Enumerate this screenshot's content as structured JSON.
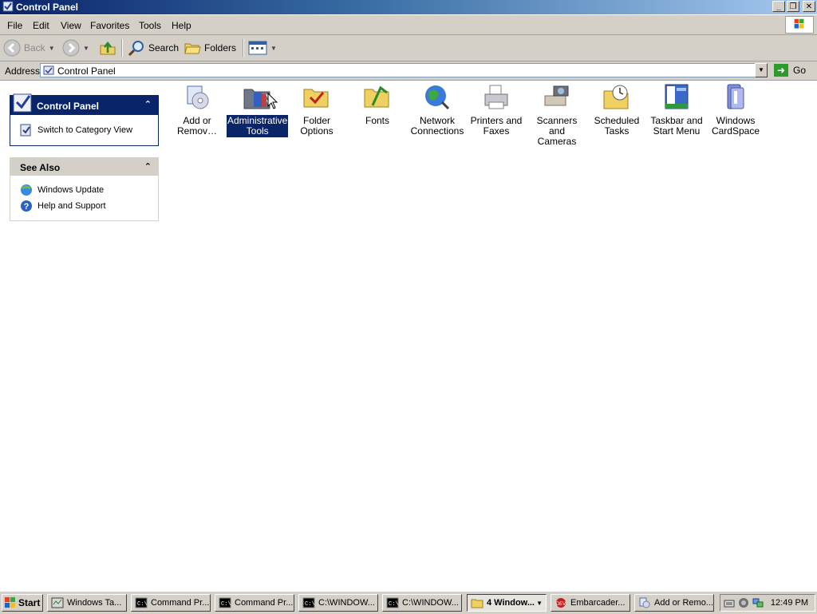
{
  "window": {
    "title": "Control Panel"
  },
  "menu": [
    "File",
    "Edit",
    "View",
    "Favorites",
    "Tools",
    "Help"
  ],
  "toolbar": {
    "back": "Back",
    "search": "Search",
    "folders": "Folders"
  },
  "address": {
    "label": "Address",
    "value": "Control Panel",
    "go": "Go"
  },
  "panes": {
    "control_panel": {
      "title": "Control Panel",
      "item": "Switch to Category View"
    },
    "see_also": {
      "title": "See Also",
      "items": [
        "Windows Update",
        "Help and Support"
      ]
    }
  },
  "icons": [
    {
      "line1": "Add or",
      "line2": "Remov…",
      "icon": "add-remove-programs-icon"
    },
    {
      "line1": "Administrative",
      "line2": "Tools",
      "icon": "administrative-tools-icon",
      "selected": true
    },
    {
      "line1": "Folder Options",
      "line2": "",
      "icon": "folder-options-icon"
    },
    {
      "line1": "Fonts",
      "line2": "",
      "icon": "fonts-folder-icon"
    },
    {
      "line1": "Network",
      "line2": "Connections",
      "icon": "network-connections-icon"
    },
    {
      "line1": "Printers and",
      "line2": "Faxes",
      "icon": "printers-faxes-icon"
    },
    {
      "line1": "Scanners and",
      "line2": "Cameras",
      "icon": "scanners-cameras-icon"
    },
    {
      "line1": "Scheduled",
      "line2": "Tasks",
      "icon": "scheduled-tasks-icon"
    },
    {
      "line1": "Taskbar and",
      "line2": "Start Menu",
      "icon": "taskbar-start-menu-icon"
    },
    {
      "line1": "Windows",
      "line2": "CardSpace",
      "icon": "windows-cardspace-icon"
    }
  ],
  "taskbar": {
    "start": "Start",
    "buttons": [
      "Windows Ta...",
      "Command Pr...",
      "Command Pr...",
      "C:\\WINDOW...",
      "C:\\WINDOW...",
      "4 Window...",
      "Embarcader...",
      "Add or Remo..."
    ],
    "clock": "12:49 PM"
  },
  "colors": {
    "selection": "#0a246a",
    "chrome": "#d4d0c8",
    "titlebar": "#0a246a"
  }
}
